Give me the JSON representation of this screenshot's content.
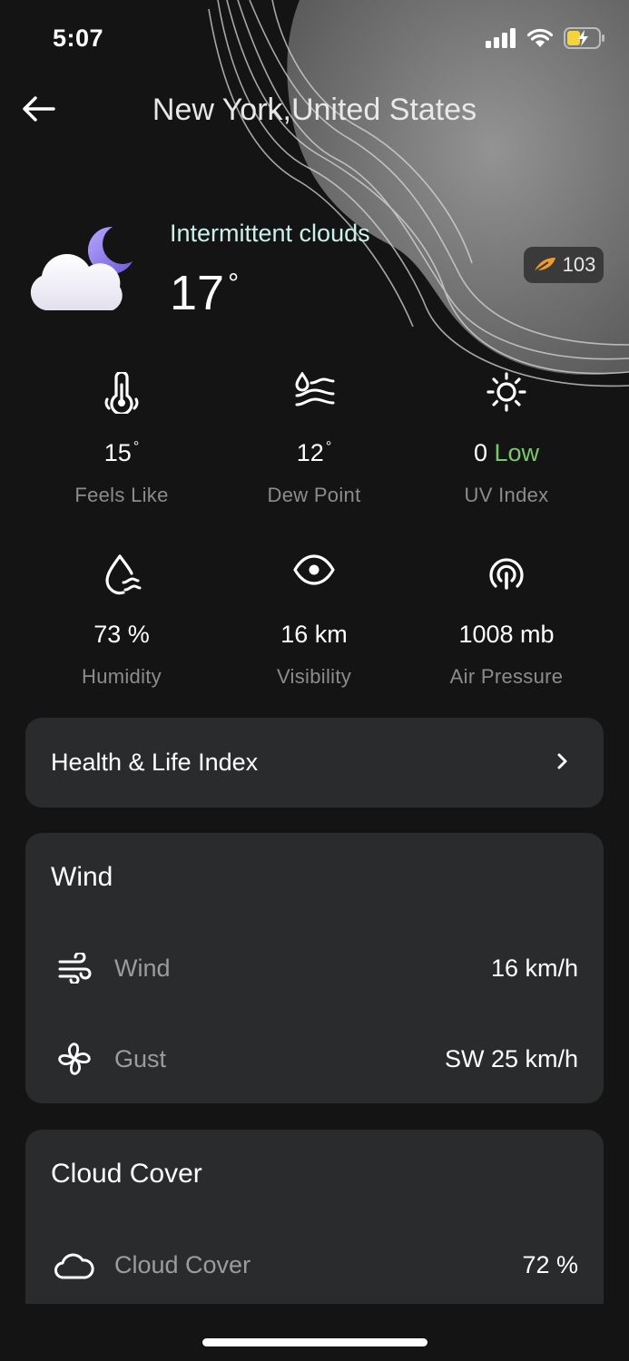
{
  "status_bar": {
    "time": "5:07"
  },
  "header": {
    "location": "New York,United States"
  },
  "current": {
    "condition": "Intermittent clouds",
    "temperature": "17",
    "degree_symbol": "°",
    "aqi": "103",
    "icon": "cloud-moon-icon"
  },
  "metrics": {
    "feels_like": {
      "value": "15",
      "deg": "°",
      "label": "Feels Like"
    },
    "dew_point": {
      "value": "12",
      "deg": "°",
      "label": "Dew Point"
    },
    "uv_index": {
      "value": "0",
      "level": "Low",
      "label": "UV Index"
    },
    "humidity": {
      "value": "73 %",
      "label": "Humidity"
    },
    "visibility": {
      "value": "16 km",
      "label": "Visibility"
    },
    "air_pressure": {
      "value": "1008 mb",
      "label": "Air Pressure"
    }
  },
  "health": {
    "title": "Health & Life Index"
  },
  "wind_card": {
    "title": "Wind",
    "rows": [
      {
        "label": "Wind",
        "value": "16 km/h",
        "icon": "wind-icon"
      },
      {
        "label": "Gust",
        "value": "SW 25 km/h",
        "icon": "gust-fan-icon"
      }
    ]
  },
  "cloud_card": {
    "title": "Cloud Cover",
    "rows": [
      {
        "label": "Cloud Cover",
        "value": "72 %",
        "icon": "cloud-icon"
      }
    ]
  },
  "colors": {
    "background": "#141414",
    "card": "#2a2b2c",
    "condition_text": "#c8f1ea",
    "uv_low": "#7cc86a",
    "label_gray": "#8c8c8c"
  }
}
